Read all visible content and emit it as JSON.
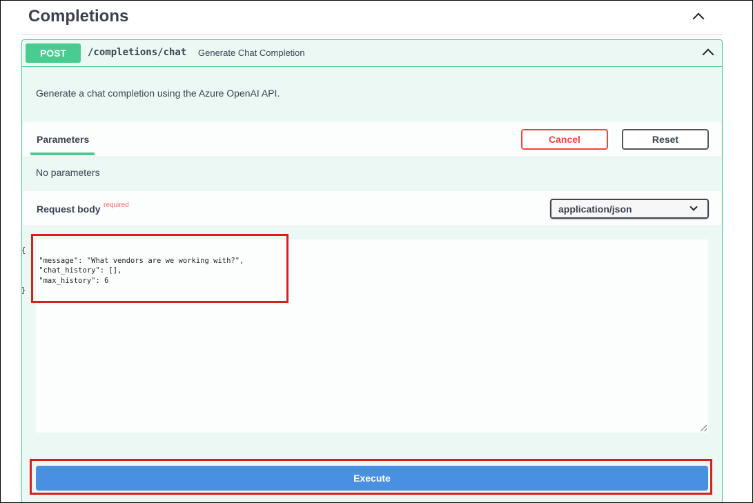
{
  "section": {
    "title": "Completions",
    "collapse_icon": "chevron-up-icon"
  },
  "operation": {
    "method": "POST",
    "path": "/completions/chat",
    "summary": "Generate Chat Completion",
    "description": "Generate a chat completion using the Azure OpenAI API.",
    "collapse_icon": "chevron-up-icon"
  },
  "parameters": {
    "tab_label": "Parameters",
    "cancel_label": "Cancel",
    "reset_label": "Reset",
    "empty_text": "No parameters"
  },
  "request_body": {
    "label": "Request body",
    "required_label": "required",
    "content_type": "application/json",
    "content_type_icon": "chevron-down-icon",
    "value": "{\n    \"message\": \"What vendors are we working with?\",\n    \"chat_history\": [],\n    \"max_history\": 6\n}"
  },
  "execute_label": "Execute",
  "colors": {
    "post_green": "#49cc90",
    "post_bg": "#ecf8f3",
    "cancel_red": "#f93e3e",
    "execute_blue": "#4990e2",
    "highlight_red": "#d91e1e"
  }
}
